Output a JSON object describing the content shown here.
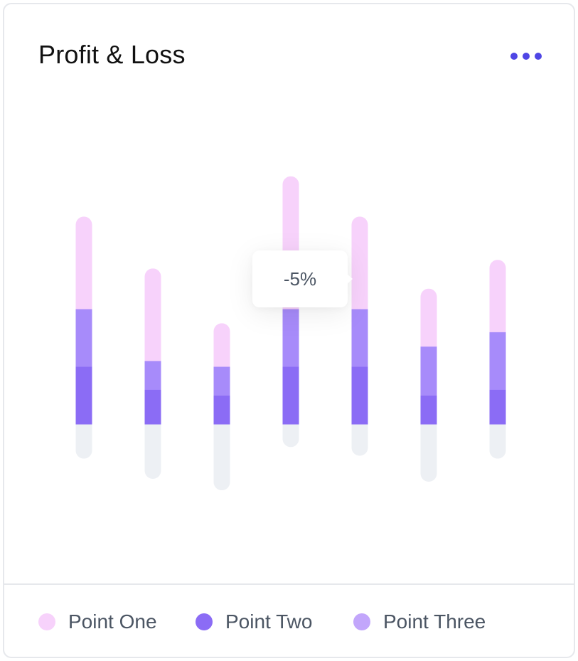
{
  "card": {
    "title": "Profit & Loss",
    "menu_icon": "more-horizontal-icon",
    "accent_color": "#4f46e5"
  },
  "tooltip": {
    "text": "-5%"
  },
  "legend": [
    {
      "label": "Point One",
      "color": "#f7d2fb"
    },
    {
      "label": "Point Two",
      "color": "#8b6cf5"
    },
    {
      "label": "Point Three",
      "color": "#c2a6fb"
    }
  ],
  "chart_data": {
    "type": "bar",
    "stacked": true,
    "categories": [
      "",
      "",
      "",
      "",
      "",
      "",
      ""
    ],
    "series": [
      {
        "name": "Point Two",
        "color": "#8b6cf5",
        "values": [
          10,
          6,
          5,
          10,
          10,
          5,
          6
        ]
      },
      {
        "name": "Point Three",
        "color": "#a78bfa",
        "values": [
          10,
          5,
          5,
          10,
          10,
          8.5,
          10
        ]
      },
      {
        "name": "Point One",
        "color": "#f7d2fb",
        "values": [
          16,
          16,
          7.5,
          23,
          16,
          10,
          12.5
        ]
      }
    ],
    "negative": {
      "color": "#edf0f4",
      "values": [
        -6,
        -9.5,
        -11.5,
        -4,
        -5.5,
        -10,
        -6
      ]
    },
    "ylim": [
      -12,
      45
    ],
    "grid": false,
    "legend_position": "bottom"
  }
}
